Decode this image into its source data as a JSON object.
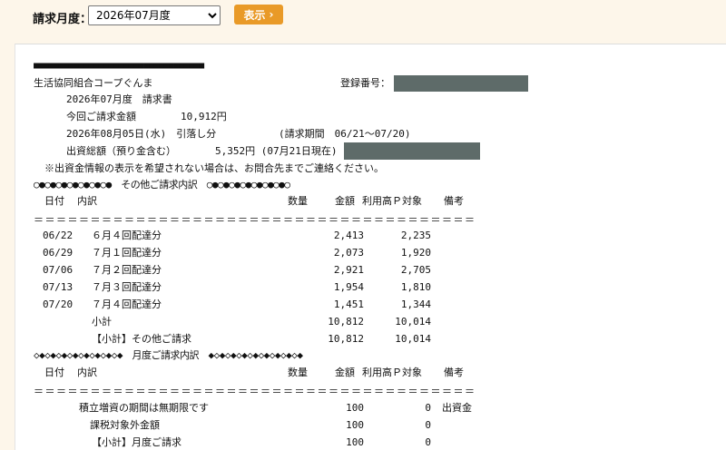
{
  "filter": {
    "label": "請求月度：",
    "selected": "2026年07月度",
    "button_label": "表示",
    "button_icon": "chevron-right-icon"
  },
  "statement": {
    "top_border": "■■■■■■■■■■■■■■■■■■■■■■■■■■■■■■■■■■",
    "coop_name": "生活協同組合コープぐんま",
    "registration_label": "登録番号：",
    "month_title": "2026年07月度　請求書",
    "amount_label": "今回ご請求金額",
    "amount_value": "10,912円",
    "debit_line": "2026年08月05日(水)　引落し分",
    "period_label": "(請求期間　06/21～07/20)",
    "capital_label": "出資総額（預り金含む）",
    "capital_value": "5,352円 (07月21日現在)",
    "notice": "※出資金情報の表示を希望されない場合は、お問合先までご連絡ください。",
    "redaction_color": "#5e6b69"
  },
  "other_section": {
    "banner": "○●○●○●○●○●○●○●　その他ご請求内訳　○●○●○●○●○●○●○●○",
    "headers": [
      "日付",
      "内訳",
      "数量",
      "金額",
      "利用高Ｐ対象",
      "備考"
    ],
    "separator": "＝＝＝＝＝＝＝＝＝＝＝＝＝＝＝＝＝＝＝＝＝＝＝＝＝＝＝＝＝＝＝＝＝＝＝＝＝＝＝",
    "rows": [
      {
        "date": "06/22",
        "desc": "６月４回配達分",
        "amount": "2,413",
        "points": "2,235"
      },
      {
        "date": "06/29",
        "desc": "７月１回配達分",
        "amount": "2,073",
        "points": "1,920"
      },
      {
        "date": "07/06",
        "desc": "７月２回配達分",
        "amount": "2,921",
        "points": "2,705"
      },
      {
        "date": "07/13",
        "desc": "７月３回配達分",
        "amount": "1,954",
        "points": "1,810"
      },
      {
        "date": "07/20",
        "desc": "７月４回配達分",
        "amount": "1,451",
        "points": "1,344"
      }
    ],
    "subtotal_label": "小計",
    "subtotal_amount": "10,812",
    "subtotal_points": "10,014",
    "section_total_label": "【小計】その他ご請求",
    "section_total_amount": "10,812",
    "section_total_points": "10,014"
  },
  "monthly_section": {
    "banner": "◇◆◇◆◇◆◇◆◇◆◇◆◇◆◇◆　月度ご請求内訳　◆◇◆◇◆◇◆◇◆◇◆◇◆◇◆◇◆",
    "headers": [
      "日付",
      "内訳",
      "数量",
      "金額",
      "利用高Ｐ対象",
      "備考"
    ],
    "separator": "＝＝＝＝＝＝＝＝＝＝＝＝＝＝＝＝＝＝＝＝＝＝＝＝＝＝＝＝＝＝＝＝＝＝＝＝＝＝＝",
    "rows": [
      {
        "desc": "積立増資の期間は無期限です",
        "amount": "100",
        "points": "0",
        "note": "出資金"
      },
      {
        "desc": "課税対象外金額",
        "amount": "100",
        "points": "0",
        "note": ""
      },
      {
        "desc": "【小計】月度ご請求",
        "amount": "100",
        "points": "0",
        "note": ""
      }
    ]
  }
}
